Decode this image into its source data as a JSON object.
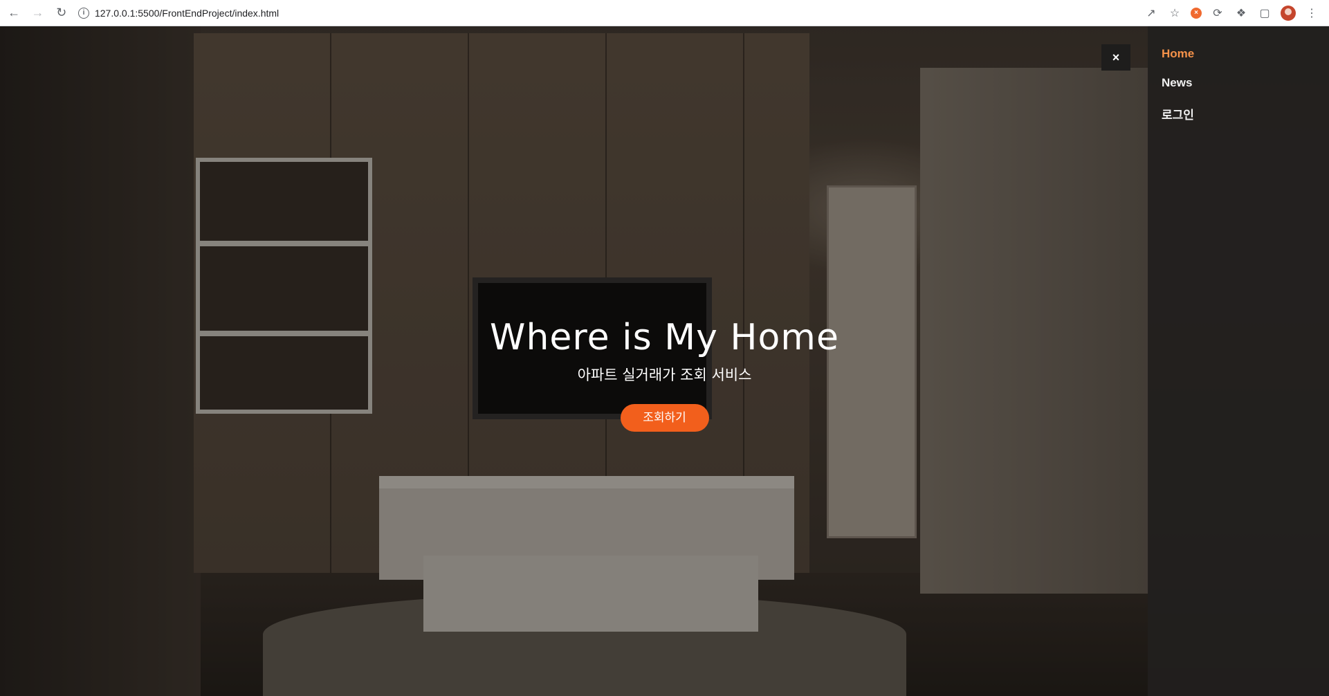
{
  "browser": {
    "url": "127.0.0.1:5500/FrontEndProject/index.html",
    "back_icon": "arrow-left-icon",
    "forward_icon": "arrow-right-icon",
    "reload_icon": "reload-icon",
    "info_icon": "info-icon",
    "share_icon": "share-icon",
    "bookmark_icon": "star-icon",
    "extensions_icon": "puzzle-icon",
    "menu_icon": "kebab-icon"
  },
  "hero": {
    "title": "Where is My Home",
    "subtitle": "아파트 실거래가 조회 서비스",
    "button_label": "조회하기"
  },
  "sidenav": {
    "close_label": "×",
    "items": [
      {
        "label": "Home",
        "active": true
      },
      {
        "label": "News",
        "active": false
      },
      {
        "label": "로그인",
        "active": false
      }
    ]
  },
  "colors": {
    "accent": "#f25f1c",
    "active_link": "#f5924a",
    "sidenav_bg": "#22201e"
  }
}
